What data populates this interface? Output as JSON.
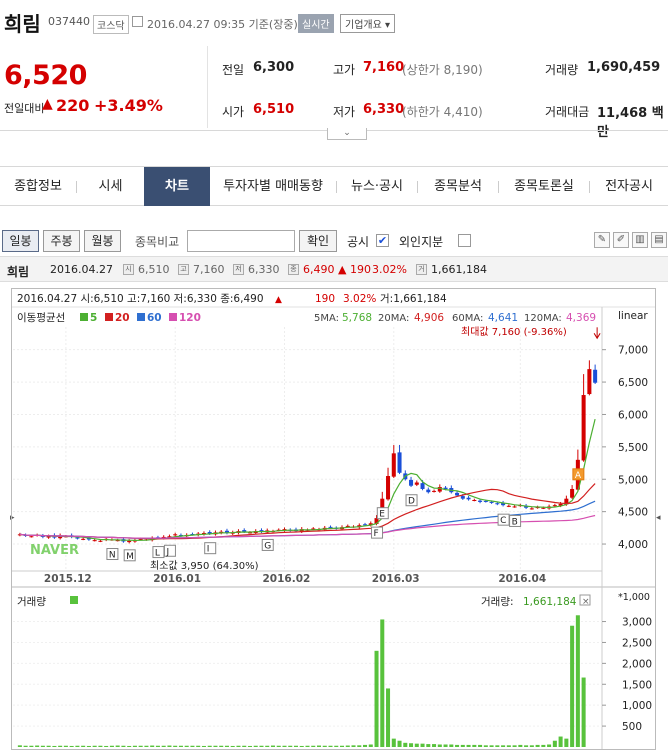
{
  "header": {
    "stock_name": "희림",
    "stock_code": "037440",
    "market": "코스닥",
    "base_time": "2016.04.27 09:35 기준(장중)",
    "realtime_label": "실시간",
    "company_overview_label": "기업개요 ▾",
    "price": "6,520",
    "prev_label": "전일대비",
    "change": "220",
    "change_pct": "+3.49%"
  },
  "quote": {
    "prev_close_label": "전일",
    "prev_close": "6,300",
    "high_label": "고가",
    "high": "7,160",
    "upper_limit": "(상한가 8,190)",
    "volume_label": "거래량",
    "volume": "1,690,459",
    "open_label": "시가",
    "open": "6,510",
    "low_label": "저가",
    "low": "6,330",
    "lower_limit": "(하한가 4,410)",
    "amount_label": "거래대금",
    "amount": "11,468 백만"
  },
  "nav": {
    "tabs": [
      "종합정보",
      "시세",
      "차트",
      "투자자별 매매동향",
      "뉴스·공시",
      "종목분석",
      "종목토론실",
      "전자공시"
    ],
    "active_index": 2
  },
  "toolbar": {
    "daily": "일봉",
    "weekly": "주봉",
    "monthly": "월봉",
    "compare_label": "종목비교",
    "confirm": "확인",
    "disclosure_label": "공시",
    "disclosure_checked": "✔",
    "foreign_label": "외인지분"
  },
  "info_row": {
    "name": "희림",
    "date": "2016.04.27",
    "open": "6,510",
    "high": "7,160",
    "low": "6,330",
    "close": "6,490",
    "change": "▲ 190",
    "change_pct": "3.02%",
    "volume": "1,661,184",
    "open_ic": "시",
    "high_ic": "고",
    "low_ic": "저",
    "close_ic": "종",
    "vol_ic": "거"
  },
  "colors": {
    "up": "#d40000",
    "down": "#1a4fd8",
    "nav_active": "#3a4f72",
    "ma5": "#4caf32",
    "ma20": "#d22020",
    "ma60": "#2f6fd0",
    "ma120": "#d64fb0",
    "volume": "#58c23c"
  },
  "chart_data": {
    "type": "candlestick",
    "top_line": "2016.04.27 시:6,510 고:7,160 저:6,330 종:6,490",
    "top_change": "190",
    "top_pct": "3.02%",
    "top_vol": "거:1,661,184",
    "ma_label": "이동평균선",
    "ma_legend": [
      {
        "name": "5",
        "color": "#4caf32"
      },
      {
        "name": "20",
        "color": "#d22020"
      },
      {
        "name": "60",
        "color": "#2f6fd0"
      },
      {
        "name": "120",
        "color": "#d64fb0"
      }
    ],
    "ma_values": [
      {
        "label": "5MA:",
        "value": "5,768"
      },
      {
        "label": "20MA:",
        "value": "4,906"
      },
      {
        "label": "60MA:",
        "value": "4,641"
      },
      {
        "label": "120MA:",
        "value": "4,369"
      }
    ],
    "scale_label": "linear",
    "max_label": "최대값 7,160 (-9.36%)",
    "min_label": "최소값 3,950 (64.30%)",
    "watermark": "NAVER",
    "yticks": [
      4000,
      4500,
      5000,
      5500,
      6000,
      6500,
      7000
    ],
    "ytick_labels": [
      "4,000",
      "4,500",
      "5,000",
      "5,500",
      "6,000",
      "6,500",
      "7,000"
    ],
    "ylim": [
      3800,
      7350
    ],
    "x_labels": [
      {
        "label": "2015.12",
        "index": 8
      },
      {
        "label": "2016.01",
        "index": 27
      },
      {
        "label": "2016.02",
        "index": 46
      },
      {
        "label": "2016.03",
        "index": 65
      },
      {
        "label": "2016.04",
        "index": 87
      }
    ],
    "closes": [
      4150,
      4130,
      4120,
      4140,
      4110,
      4120,
      4100,
      4130,
      4120,
      4110,
      4090,
      4080,
      4070,
      4060,
      4050,
      4080,
      4070,
      4060,
      4040,
      4050,
      4060,
      4080,
      4070,
      4090,
      4100,
      4110,
      4120,
      4150,
      4130,
      4140,
      4150,
      4160,
      4170,
      4160,
      4180,
      4190,
      4170,
      4180,
      4200,
      4190,
      4180,
      4200,
      4190,
      4210,
      4200,
      4220,
      4230,
      4210,
      4200,
      4230,
      4220,
      4240,
      4230,
      4250,
      4260,
      4240,
      4260,
      4280,
      4270,
      4290,
      4300,
      4320,
      4400,
      4700,
      5050,
      5400,
      5100,
      5000,
      4900,
      4950,
      4850,
      4800,
      4820,
      4880,
      4850,
      4800,
      4750,
      4700,
      4690,
      4680,
      4650,
      4660,
      4640,
      4620,
      4600,
      4590,
      4580,
      4600,
      4560,
      4550,
      4570,
      4560,
      4580,
      4600,
      4620,
      4700,
      4850,
      5300,
      6300,
      6700,
      6490
    ],
    "candles_up_ratio": 0.5,
    "event_markers": [
      {
        "label": "N",
        "index": 16
      },
      {
        "label": "M",
        "index": 19
      },
      {
        "label": "L",
        "index": 24
      },
      {
        "label": "J",
        "index": 26
      },
      {
        "label": "I",
        "index": 33
      },
      {
        "label": "G",
        "index": 43
      },
      {
        "label": "F",
        "index": 62
      },
      {
        "label": "E",
        "index": 63
      },
      {
        "label": "D",
        "index": 68
      },
      {
        "label": "C",
        "index": 84
      },
      {
        "label": "B",
        "index": 86
      },
      {
        "label": "A",
        "index": 97
      }
    ],
    "volume_label": "거래량",
    "volume_value_label": "거래량:",
    "volume_value": "1,661,184",
    "volume_unit": "*1,000",
    "vol_yticks": [
      500,
      1000,
      1500,
      2000,
      2500,
      3000
    ],
    "vol_ytick_labels": [
      "500",
      "1,000",
      "1,500",
      "2,000",
      "2,500",
      "3,000"
    ],
    "vol_ylim": [
      0,
      3300
    ],
    "volumes": [
      40,
      30,
      30,
      35,
      30,
      30,
      25,
      30,
      30,
      25,
      30,
      30,
      25,
      30,
      30,
      25,
      30,
      35,
      30,
      25,
      30,
      30,
      30,
      35,
      30,
      30,
      35,
      30,
      30,
      30,
      30,
      30,
      25,
      30,
      30,
      30,
      30,
      25,
      30,
      30,
      25,
      30,
      30,
      30,
      35,
      30,
      30,
      30,
      30,
      25,
      30,
      30,
      35,
      30,
      30,
      30,
      30,
      35,
      40,
      40,
      50,
      60,
      2300,
      3050,
      1400,
      200,
      150,
      100,
      90,
      80,
      80,
      70,
      70,
      60,
      60,
      60,
      50,
      50,
      50,
      50,
      50,
      40,
      40,
      40,
      40,
      40,
      40,
      50,
      40,
      40,
      50,
      50,
      60,
      150,
      250,
      200,
      2900,
      3150,
      1661
    ]
  }
}
